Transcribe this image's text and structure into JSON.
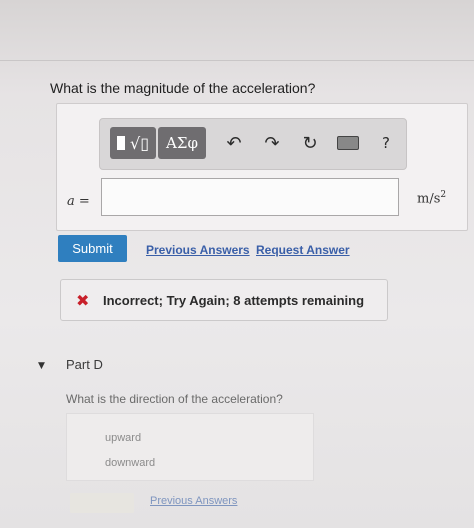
{
  "question": "What is the magnitude of the acceleration?",
  "toolbar": {
    "templates_icon": "square-root-template-icon",
    "symbols_label": "ΑΣφ",
    "undo_icon": "undo-arrow-icon",
    "redo_icon": "redo-arrow-icon",
    "reset_icon": "reset-icon",
    "keyboard_icon": "keyboard-icon",
    "help_label": "?"
  },
  "answer": {
    "variable_label": "a =",
    "input_value": "",
    "unit_base": "m/s",
    "unit_exponent": "2"
  },
  "actions": {
    "submit_label": "Submit",
    "previous_answers_label": "Previous Answers",
    "request_answer_label": "Request Answer"
  },
  "feedback": {
    "icon": "x-mark-icon",
    "text": "Incorrect; Try Again; 8 attempts remaining",
    "color": "#c8202a"
  },
  "part_d": {
    "title": "Part D",
    "question": "What is the direction of the acceleration?",
    "choices": [
      "upward",
      "downward"
    ],
    "previous_answers_label": "Previous Answers"
  },
  "colors": {
    "submit_bg": "#2f7fbf",
    "link": "#3a5fa8"
  }
}
